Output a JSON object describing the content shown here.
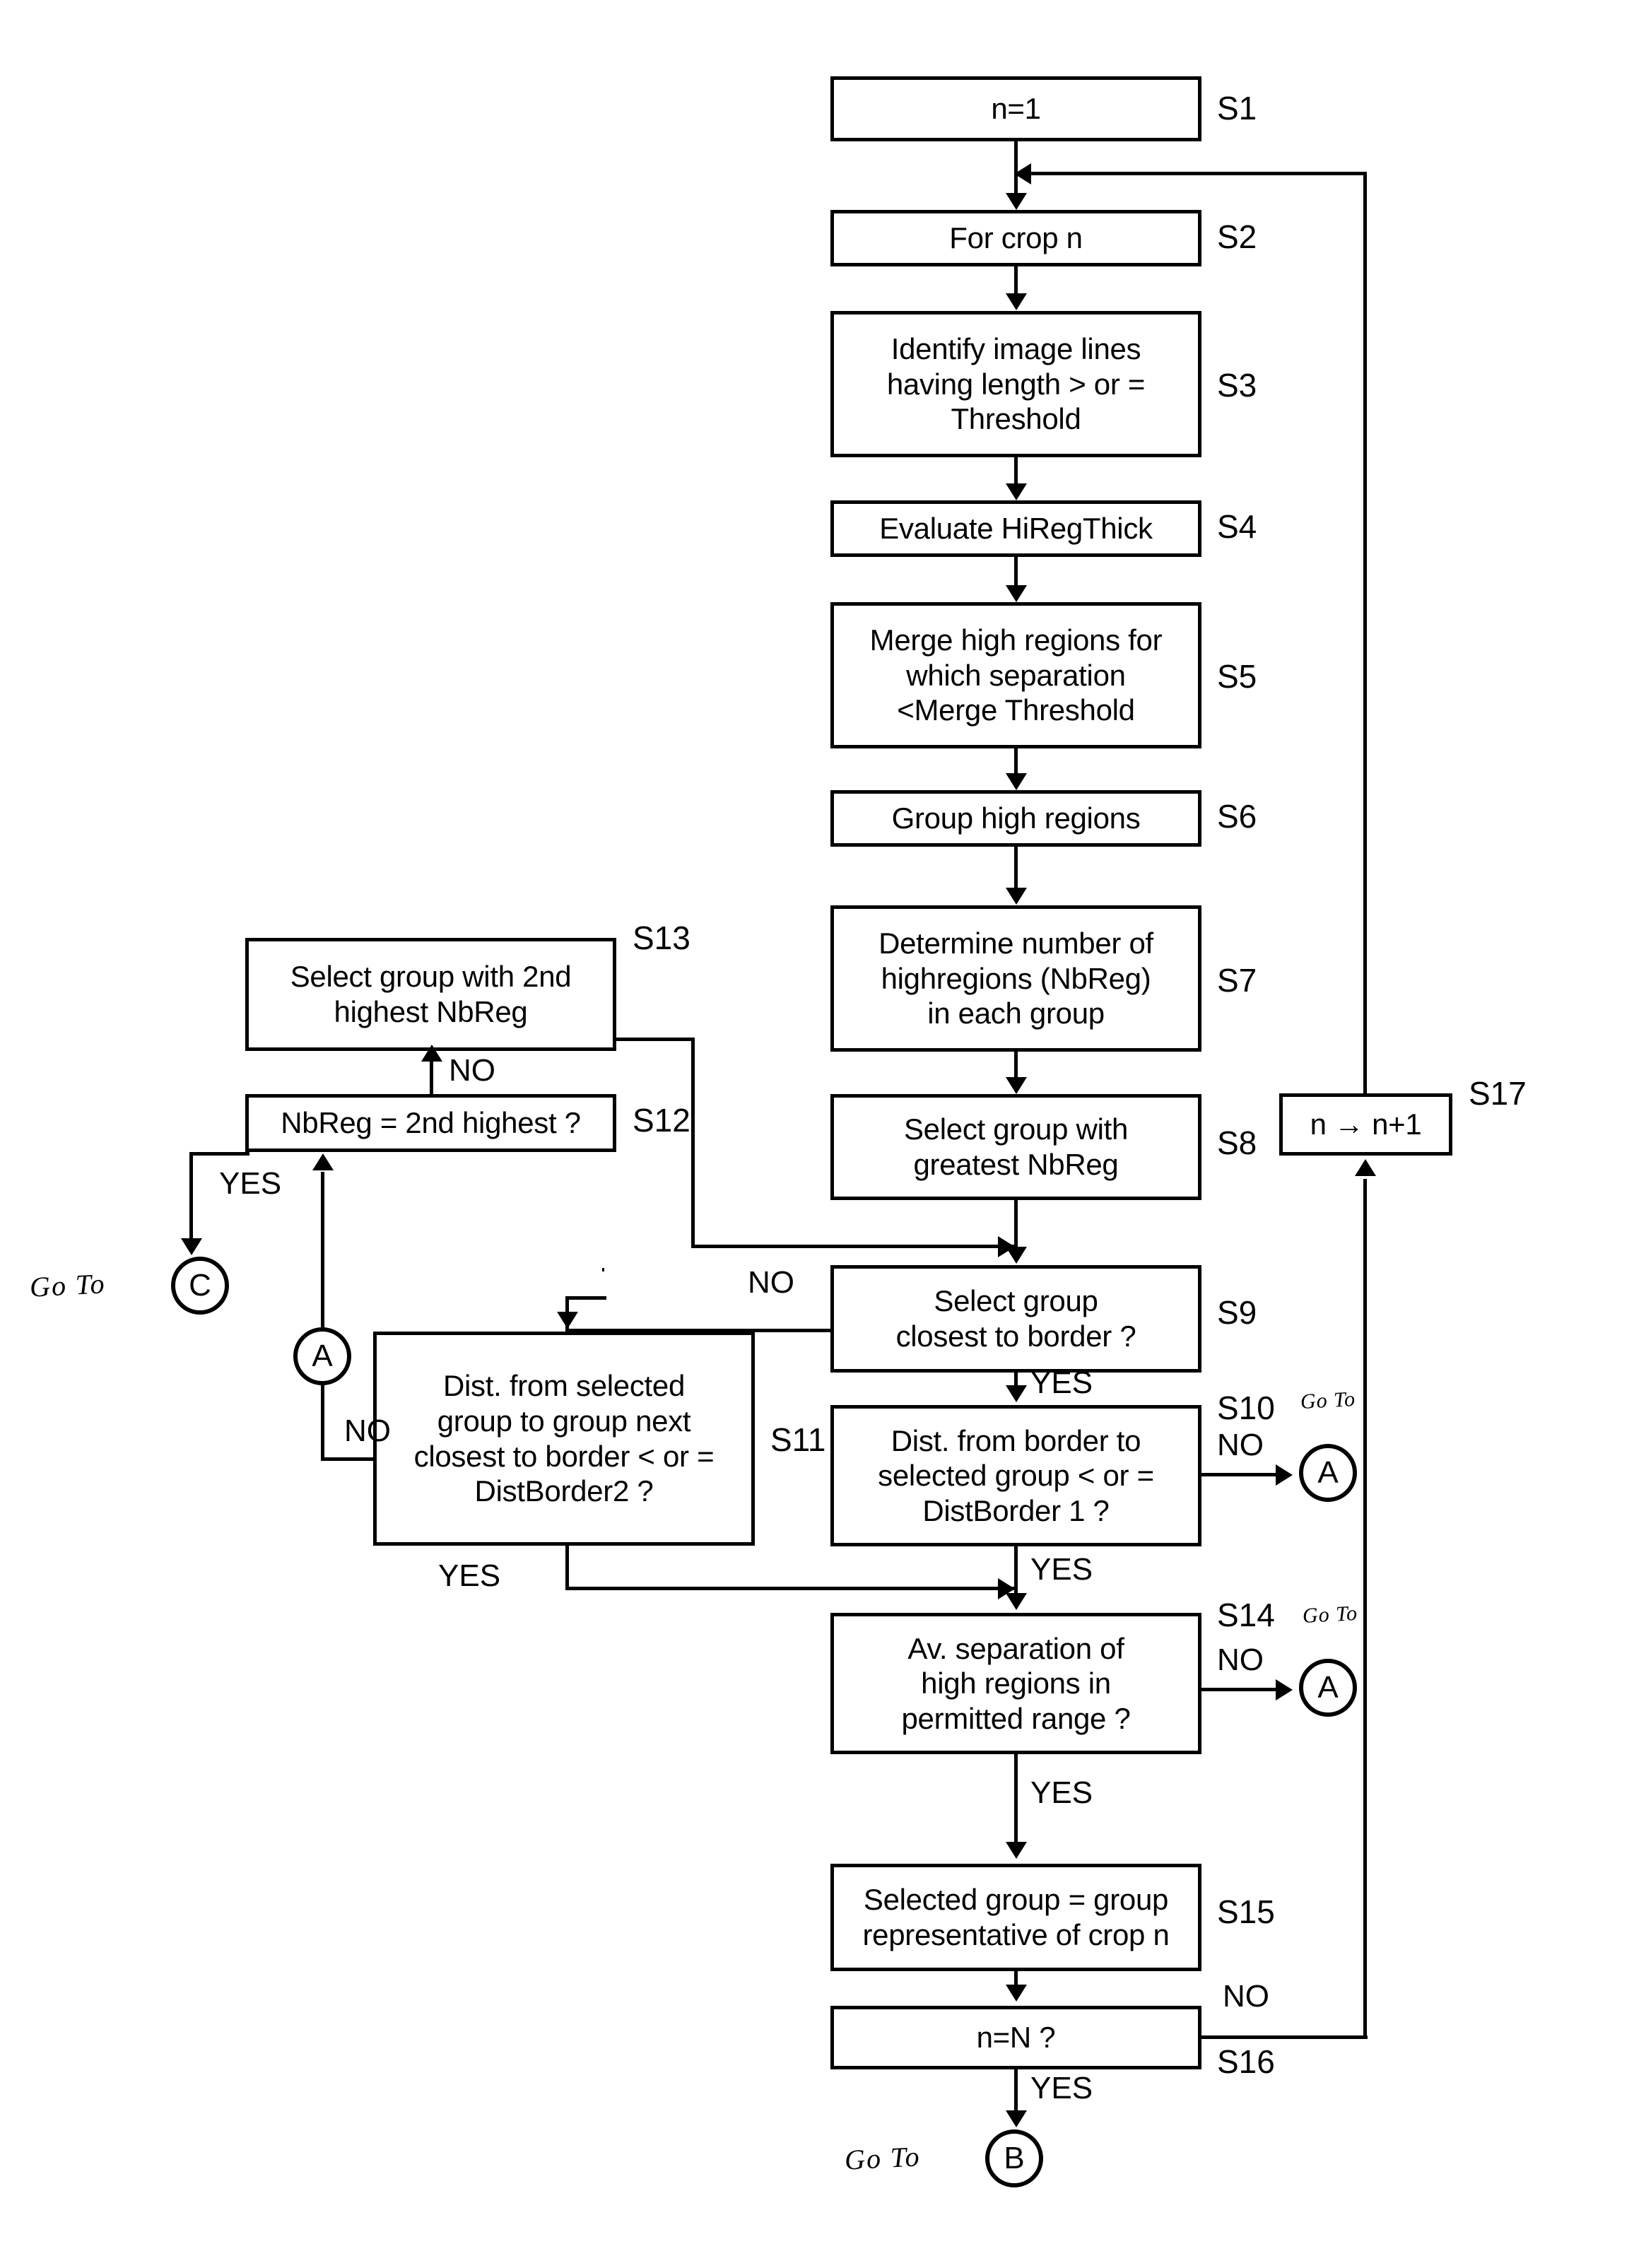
{
  "diagram": {
    "title": "Crop group selection flowchart",
    "ink_color": "#000000",
    "background_color": "#ffffff"
  },
  "steps": [
    {
      "id": "S1",
      "label": "n=1"
    },
    {
      "id": "S2",
      "label": "For crop n"
    },
    {
      "id": "S3",
      "label": "Identify image lines\nhaving length > or =\nThreshold"
    },
    {
      "id": "S4",
      "label": "Evaluate HiRegThick"
    },
    {
      "id": "S5",
      "label": "Merge high regions for\nwhich separation\n<Merge Threshold"
    },
    {
      "id": "S6",
      "label": "Group high regions"
    },
    {
      "id": "S7",
      "label": "Determine number of\nhighregions (NbReg)\nin each group"
    },
    {
      "id": "S8",
      "label": "Select group with\ngreatest NbReg"
    },
    {
      "id": "S9",
      "label": "Select group\nclosest to border ?"
    },
    {
      "id": "S10",
      "label": "Dist. from border to\nselected group < or =\nDistBorder 1 ?"
    },
    {
      "id": "S11",
      "label": "Dist. from selected\ngroup to group next\nclosest to border < or =\nDistBorder2 ?"
    },
    {
      "id": "S12",
      "label": "NbReg = 2nd highest ?"
    },
    {
      "id": "S13",
      "label": "Select group with 2nd\nhighest NbReg"
    },
    {
      "id": "S14",
      "label": "Av. separation of\nhigh regions in\npermitted range ?"
    },
    {
      "id": "S15",
      "label": "Selected group = group\nrepresentative of crop n"
    },
    {
      "id": "S16",
      "label": "n=N ?"
    },
    {
      "id": "S17",
      "label": "n → n+1"
    }
  ],
  "edge_labels": {
    "s12_no": "NO",
    "s12_yes": "YES",
    "s9_no": "NO",
    "s9_yes": "YES",
    "s10_no": "NO",
    "s10_yes": "YES",
    "s11_no": "NO",
    "s11_yes": "YES",
    "s14_no": "NO",
    "s14_yes": "YES",
    "s16_no": "NO",
    "s16_yes": "YES"
  },
  "connectors": [
    {
      "key": "c",
      "label": "C",
      "goto_text": "Go To"
    },
    {
      "key": "a_mid",
      "label": "A"
    },
    {
      "key": "a_s10",
      "label": "A",
      "goto_text": "Go To"
    },
    {
      "key": "a_s14",
      "label": "A",
      "goto_text": "Go To"
    },
    {
      "key": "b",
      "label": "B",
      "goto_text": "Go To"
    }
  ],
  "goto_labels": {
    "c": "Go To",
    "s10": "Go To",
    "s14": "Go To",
    "b": "Go To"
  }
}
